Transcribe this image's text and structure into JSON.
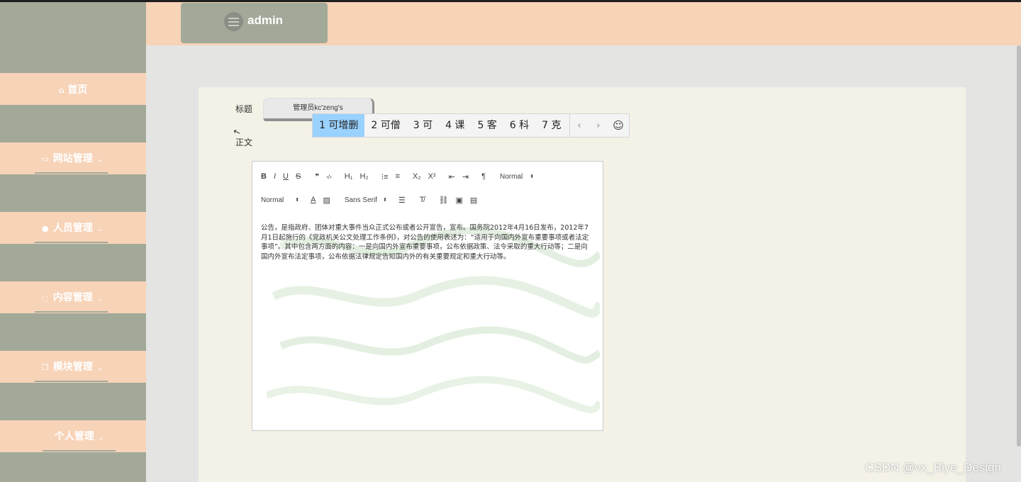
{
  "header": {
    "username": "admin"
  },
  "sidebar": {
    "home": {
      "icon": "home-icon",
      "label": "首页"
    },
    "groups": [
      {
        "icon": "monitor-icon",
        "label": "网站管理"
      },
      {
        "icon": "user-icon",
        "label": "人员管理"
      },
      {
        "icon": "chat-icon",
        "label": "内容管理"
      },
      {
        "icon": "copy-icon",
        "label": "模块管理"
      },
      {
        "icon": "",
        "label": "个人管理"
      }
    ]
  },
  "form": {
    "title_label": "标题",
    "title_value": "管理员kc'zeng's",
    "body_label": "正文"
  },
  "ime": {
    "candidates": [
      "1 可增删",
      "2 可僧",
      "3 可",
      "4 课",
      "5 客",
      "6 科",
      "7 克"
    ],
    "prev": "‹",
    "next": "›",
    "emoji": "☺"
  },
  "toolbar": {
    "row1": [
      "B",
      "I",
      "U",
      "S",
      "❞",
      "‹/›",
      "H₁",
      "H₂",
      "⁝≡",
      "≡",
      "X₂",
      "X²",
      "⇤",
      "⇥",
      "¶"
    ],
    "header_select": "Normal",
    "size_select": "Normal",
    "font_select": "Sans Serif"
  },
  "editor": {
    "content": "公告，是指政府、团体对重大事件当众正式公布或者公开宣告，宣布。国务院2012年4月16日发布，2012年7月1日起施行的《党政机关公文处理工作条例》，对公告的使用表述为：“适用于向国内外宣布重要事项或者法定事项”。其中包含两方面的内容：一是向国内外宣布重要事项，公布依据政策、法令采取的重大行动等；二是向国内外宣布法定事项，公布依据法律规定告知国内外的有关重要规定和重大行动等。"
  },
  "footer": {
    "watermark": "CSDN @vx_Biye_Design"
  }
}
